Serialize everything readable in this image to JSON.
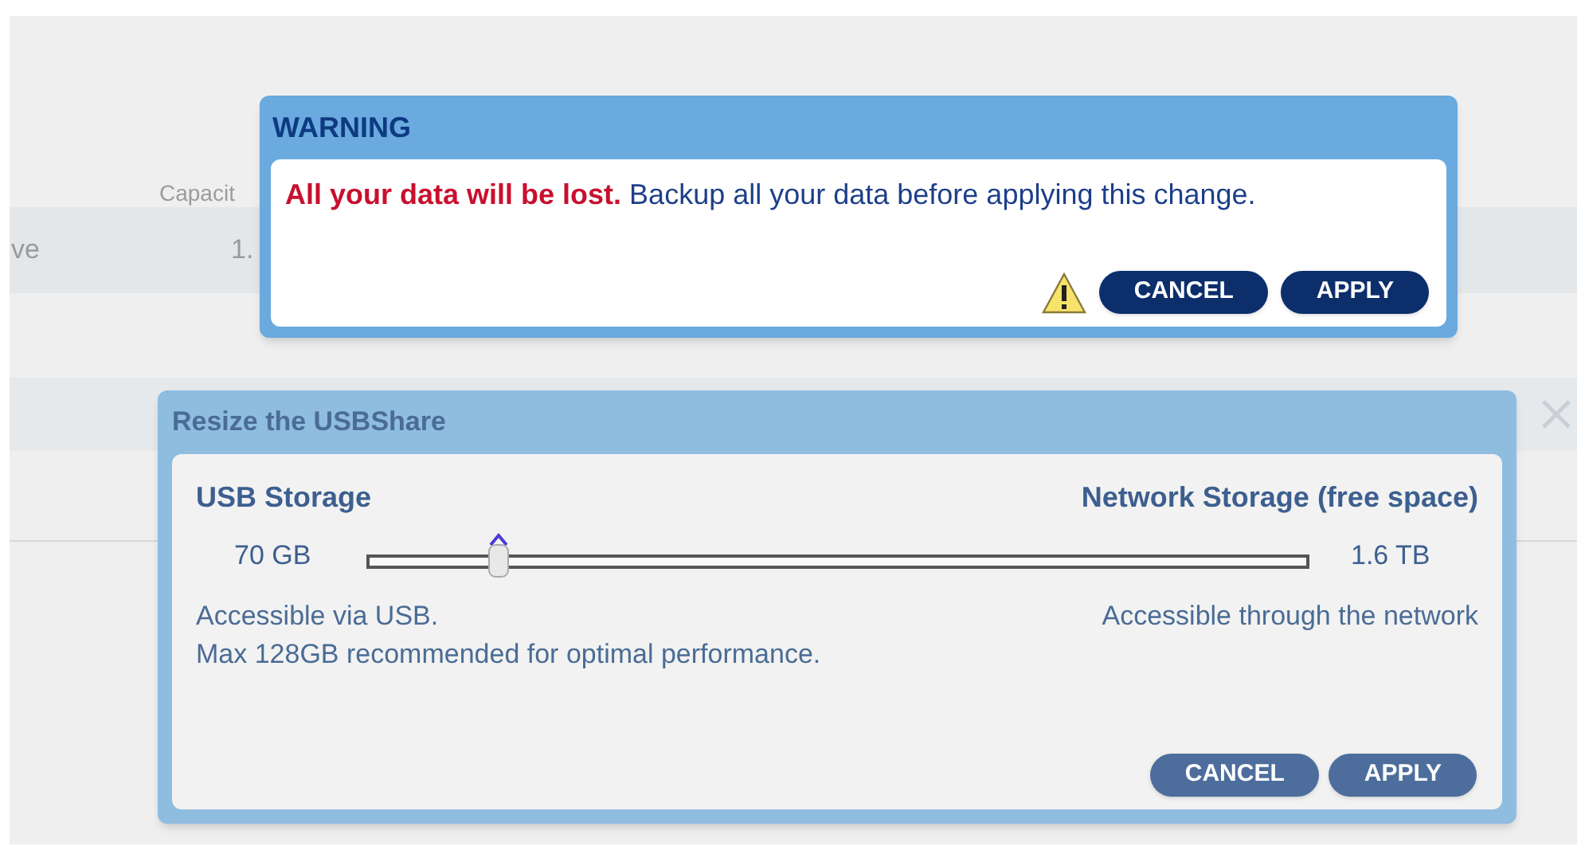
{
  "background": {
    "column_heading": "Capacit",
    "row_label": "ve",
    "row_value": "1."
  },
  "warning": {
    "title": "WARNING",
    "alert": "All your data will be lost.",
    "message": "Backup all your data before applying this change.",
    "buttons": [
      "CANCEL",
      "APPLY"
    ]
  },
  "resize": {
    "title": "Resize the USBShare",
    "left": {
      "label": "USB Storage",
      "value": "70 GB",
      "notes": [
        "Accessible via USB.",
        "Max 128GB recommended for optimal performance."
      ]
    },
    "right": {
      "label": "Network Storage (free space)",
      "value": "1.6 TB",
      "notes": [
        "Accessible through the network"
      ]
    },
    "slider": {
      "level": 0.14
    },
    "buttons": [
      "CANCEL",
      "APPLY"
    ]
  }
}
